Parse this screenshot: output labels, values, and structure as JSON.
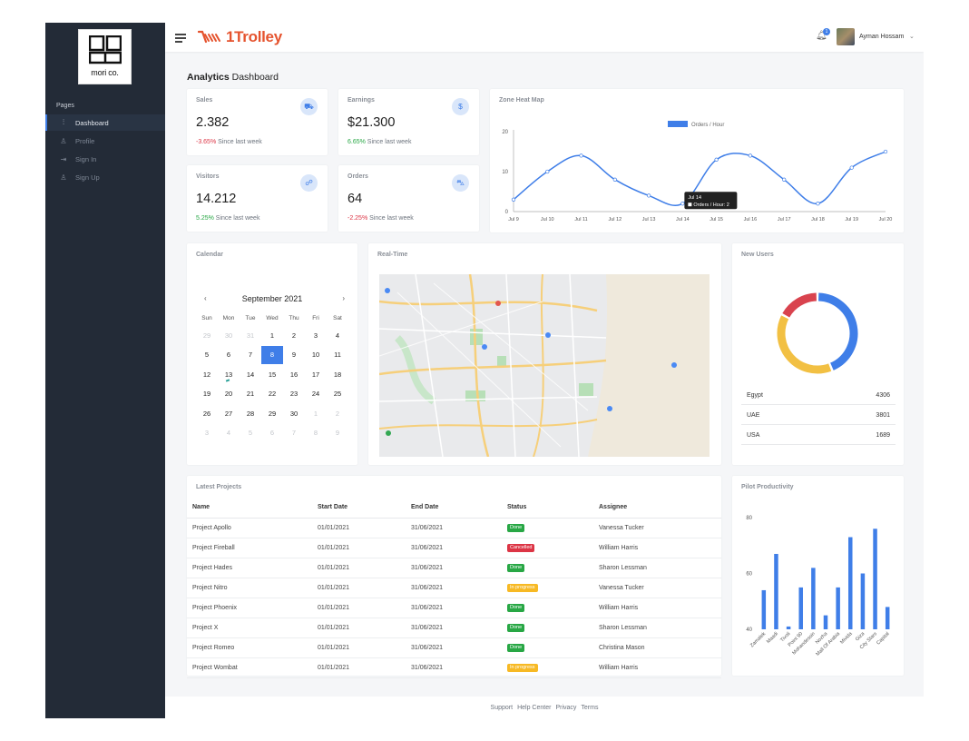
{
  "app": {
    "brand": "1Trolley",
    "logo_text": "mori co."
  },
  "sidebar": {
    "section": "Pages",
    "items": [
      {
        "label": "Dashboard",
        "icon": "sliders-icon",
        "glyph": "⫶",
        "active": true
      },
      {
        "label": "Profile",
        "icon": "user-icon",
        "glyph": "♙",
        "active": false
      },
      {
        "label": "Sign In",
        "icon": "sign-in-icon",
        "glyph": "⇥",
        "active": false
      },
      {
        "label": "Sign Up",
        "icon": "user-plus-icon",
        "glyph": "♙",
        "active": false
      }
    ]
  },
  "topbar": {
    "notification_count": "1",
    "user_name": "Ayman Hossam"
  },
  "page": {
    "title_bold": "Analytics",
    "title_rest": " Dashboard"
  },
  "stats": [
    {
      "title": "Sales",
      "value": "2.382",
      "change": "-3.65%",
      "change_type": "neg",
      "note": " Since last week",
      "icon": "truck-icon",
      "glyph": "⛟"
    },
    {
      "title": "Earnings",
      "value": "$21.300",
      "change": "6.65%",
      "change_type": "pos",
      "note": " Since last week",
      "icon": "dollar-icon",
      "glyph": "$"
    },
    {
      "title": "Visitors",
      "value": "14.212",
      "change": "5.25%",
      "change_type": "pos",
      "note": " Since last week",
      "icon": "users-icon",
      "glyph": "☍"
    },
    {
      "title": "Orders",
      "value": "64",
      "change": "-2.25%",
      "change_type": "neg",
      "note": " Since last week",
      "icon": "cart-icon",
      "glyph": "⛍"
    }
  ],
  "heatmap": {
    "title": "Zone Heat Map",
    "tooltip": {
      "title": "Jul 14",
      "label": "Orders / Hour: 2"
    }
  },
  "calendar": {
    "title": "Calendar",
    "month": "September 2021",
    "prev": "‹",
    "next": "›",
    "weekdays": [
      "Sun",
      "Mon",
      "Tue",
      "Wed",
      "Thu",
      "Fri",
      "Sat"
    ],
    "weeks": [
      [
        "29",
        "30",
        "31",
        "1",
        "2",
        "3",
        "4"
      ],
      [
        "5",
        "6",
        "7",
        "8",
        "9",
        "10",
        "11"
      ],
      [
        "12",
        "13",
        "14",
        "15",
        "16",
        "17",
        "18"
      ],
      [
        "19",
        "20",
        "21",
        "22",
        "23",
        "24",
        "25"
      ],
      [
        "26",
        "27",
        "28",
        "29",
        "30",
        "1",
        "2"
      ],
      [
        "3",
        "4",
        "5",
        "6",
        "7",
        "8",
        "9"
      ]
    ],
    "selected": "8"
  },
  "realtime": {
    "title": "Real-Time"
  },
  "new_users": {
    "title": "New Users",
    "rows": [
      {
        "country": "Egypt",
        "value": "4306"
      },
      {
        "country": "UAE",
        "value": "3801"
      },
      {
        "country": "USA",
        "value": "1689"
      }
    ]
  },
  "projects": {
    "title": "Latest Projects",
    "columns": [
      "Name",
      "Start Date",
      "End Date",
      "Status",
      "Assignee"
    ],
    "rows": [
      {
        "name": "Project Apollo",
        "start": "01/01/2021",
        "end": "31/06/2021",
        "status": "Done",
        "status_type": "done",
        "assignee": "Vanessa Tucker"
      },
      {
        "name": "Project Fireball",
        "start": "01/01/2021",
        "end": "31/06/2021",
        "status": "Cancelled",
        "status_type": "cancelled",
        "assignee": "William Harris"
      },
      {
        "name": "Project Hades",
        "start": "01/01/2021",
        "end": "31/06/2021",
        "status": "Done",
        "status_type": "done",
        "assignee": "Sharon Lessman"
      },
      {
        "name": "Project Nitro",
        "start": "01/01/2021",
        "end": "31/06/2021",
        "status": "In progress",
        "status_type": "progress",
        "assignee": "Vanessa Tucker"
      },
      {
        "name": "Project Phoenix",
        "start": "01/01/2021",
        "end": "31/06/2021",
        "status": "Done",
        "status_type": "done",
        "assignee": "William Harris"
      },
      {
        "name": "Project X",
        "start": "01/01/2021",
        "end": "31/06/2021",
        "status": "Done",
        "status_type": "done",
        "assignee": "Sharon Lessman"
      },
      {
        "name": "Project Romeo",
        "start": "01/01/2021",
        "end": "31/06/2021",
        "status": "Done",
        "status_type": "done",
        "assignee": "Christina Mason"
      },
      {
        "name": "Project Wombat",
        "start": "01/01/2021",
        "end": "31/06/2021",
        "status": "In progress",
        "status_type": "progress",
        "assignee": "William Harris"
      }
    ]
  },
  "pilot": {
    "title": "Pilot Productivity"
  },
  "footer": {
    "links": [
      "Support",
      "Help Center",
      "Privacy",
      "Terms"
    ]
  },
  "colors": {
    "accent": "#3f7ee8",
    "brand": "#e5532e",
    "sidebar": "#232b37",
    "yellow": "#f2c043",
    "red": "#d9434e"
  },
  "chart_data": [
    {
      "type": "line",
      "title": "Zone Heat Map",
      "series": [
        {
          "name": "Orders / Hour",
          "values": [
            3,
            10,
            14,
            8,
            4,
            2,
            13,
            14,
            8,
            2,
            11,
            15
          ]
        }
      ],
      "x": [
        "Jul 9",
        "Jul 10",
        "Jul 11",
        "Jul 12",
        "Jul 13",
        "Jul 14",
        "Jul 15",
        "Jul 16",
        "Jul 17",
        "Jul 18",
        "Jul 19",
        "Jul 20"
      ],
      "ylim": [
        0,
        20
      ],
      "yticks": [
        "0",
        "10",
        "20"
      ],
      "legend": "top"
    },
    {
      "type": "pie",
      "title": "New Users",
      "categories": [
        "Egypt",
        "UAE",
        "USA"
      ],
      "values": [
        4306,
        3801,
        1689
      ],
      "colors": [
        "#3f7ee8",
        "#f2c043",
        "#d9434e"
      ]
    },
    {
      "type": "bar",
      "title": "Pilot Productivity",
      "categories": [
        "Zamalek",
        "Maadi",
        "Tivoli",
        "Point 90",
        "Mohandessin",
        "Nozha",
        "Mall Of Arabia",
        "Mivida",
        "Giza",
        "City Stars",
        "Capital"
      ],
      "values": [
        54,
        67,
        41,
        55,
        62,
        45,
        55,
        73,
        60,
        76,
        48
      ],
      "ylim": [
        40,
        80
      ],
      "yticks": [
        "40",
        "60",
        "80"
      ]
    }
  ]
}
